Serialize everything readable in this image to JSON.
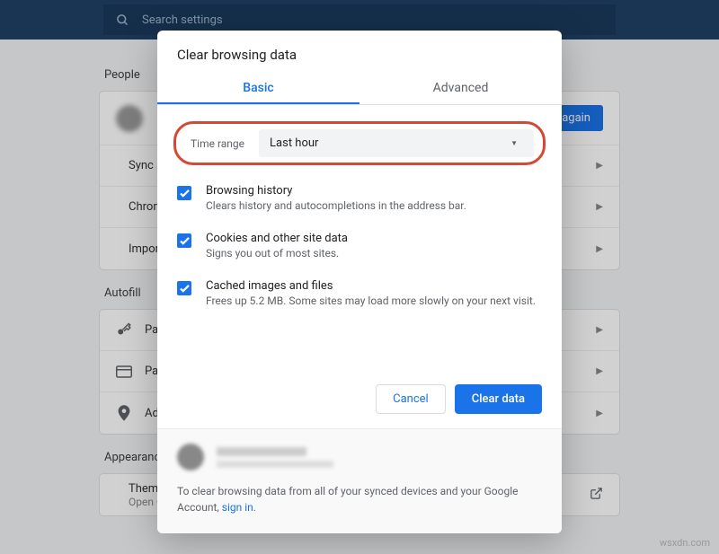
{
  "search": {
    "placeholder": "Search settings"
  },
  "bg": {
    "sections": {
      "people": "People",
      "autofill": "Autofill",
      "appearance": "Appearance"
    },
    "rows": {
      "signin": "n in again",
      "sync": "Sync and C",
      "chrome": "Chrome na",
      "import": "Import boo",
      "pass": "Pas",
      "pay": "Pay",
      "add": "Ad",
      "themes": "Themes",
      "themes_sub": "Open Chro"
    }
  },
  "dialog": {
    "title": "Clear browsing data",
    "tabs": {
      "basic": "Basic",
      "advanced": "Advanced"
    },
    "timerange": {
      "label": "Time range",
      "value": "Last hour"
    },
    "opts": [
      {
        "title": "Browsing history",
        "desc": "Clears history and autocompletions in the address bar."
      },
      {
        "title": "Cookies and other site data",
        "desc": "Signs you out of most sites."
      },
      {
        "title": "Cached images and files",
        "desc": "Frees up 5.2 MB. Some sites may load more slowly on your next visit."
      }
    ],
    "actions": {
      "cancel": "Cancel",
      "clear": "Clear data"
    },
    "footer": {
      "msg": "To clear browsing data from all of your synced devices and your Google Account, ",
      "link": "sign in"
    }
  },
  "watermark": "wsxdn.com"
}
